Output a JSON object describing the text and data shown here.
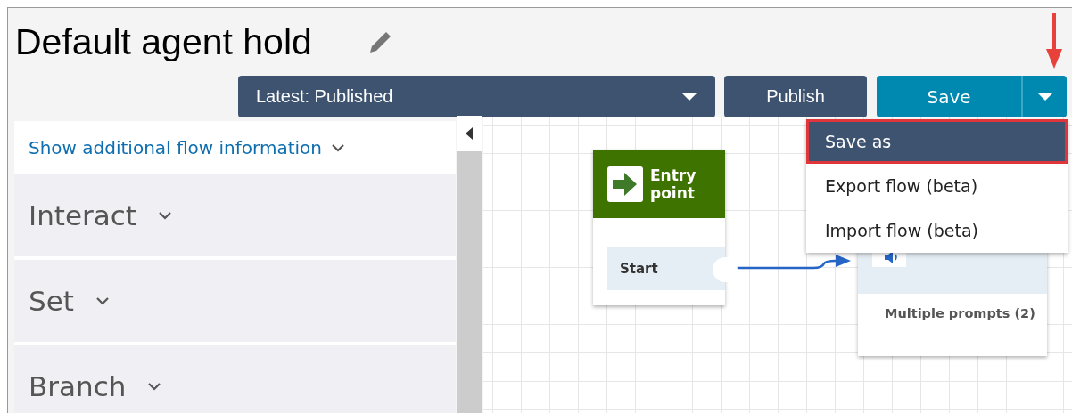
{
  "flow": {
    "title": "Default agent hold"
  },
  "toolbar": {
    "version_dropdown": {
      "value": "Latest: Published"
    },
    "publish_button": "Publish",
    "save_button": "Save"
  },
  "save_menu": {
    "open": true,
    "items": [
      {
        "label": "Save as",
        "selected": true
      },
      {
        "label": "Export flow (beta)",
        "selected": false
      },
      {
        "label": "Import flow (beta)",
        "selected": false
      }
    ]
  },
  "sidebar": {
    "info_link": "Show additional flow information",
    "sections": [
      {
        "label": "Interact",
        "expanded": false
      },
      {
        "label": "Set",
        "expanded": false
      },
      {
        "label": "Branch",
        "expanded": false
      }
    ]
  },
  "canvas": {
    "blocks": [
      {
        "kind": "entry",
        "title": "Entry point",
        "branches": [
          "Start"
        ]
      },
      {
        "kind": "prompt",
        "subtitle": "Multiple prompts (2)"
      }
    ]
  }
}
